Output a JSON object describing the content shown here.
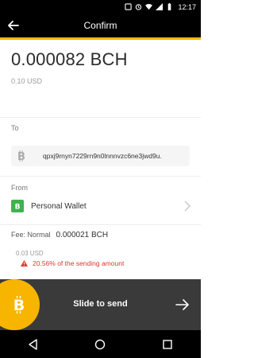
{
  "status": {
    "time": "12:17"
  },
  "header": {
    "title": "Confirm"
  },
  "amount": {
    "crypto": "0.000082 BCH",
    "fiat": "0.10 USD"
  },
  "to": {
    "label": "To",
    "address": "qpxj9rnyn7229rn9n0lnnnvzc6ne3jwd9u."
  },
  "from": {
    "label": "From",
    "wallet_name": "Personal Wallet"
  },
  "fee": {
    "label": "Fee: Normal",
    "value": "0.000021 BCH",
    "fiat": "0.03 USD",
    "warning": "20.56% of the sending amount"
  },
  "slide": {
    "label": "Slide to send"
  },
  "colors": {
    "accent": "#f7b500",
    "warning": "#e0362c",
    "wallet": "#3fb34f"
  }
}
